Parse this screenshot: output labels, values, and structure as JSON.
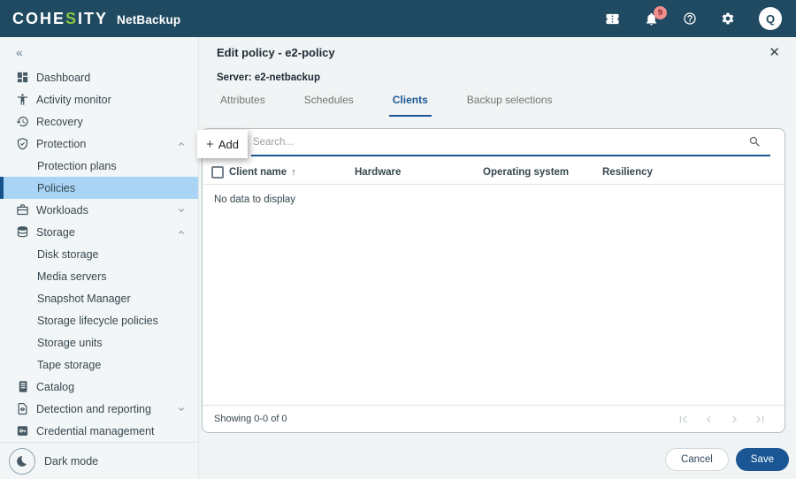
{
  "topbar": {
    "brand_pre": "COHE",
    "brand_s": "S",
    "brand_post": "ITY",
    "product": "NetBackup",
    "notification_count": "9",
    "avatar_letter": "Q"
  },
  "icons": {
    "collapse_glyph": "«",
    "close_glyph": "✕",
    "plus_glyph": "+",
    "sort_asc_glyph": "↑"
  },
  "sidebar": {
    "items": [
      {
        "label": "Dashboard",
        "icon": "dashboard-icon"
      },
      {
        "label": "Activity monitor",
        "icon": "activity-monitor-icon"
      },
      {
        "label": "Recovery",
        "icon": "recovery-icon"
      },
      {
        "label": "Protection",
        "icon": "shield-check-icon",
        "state": "expanded"
      },
      {
        "label": "Protection plans",
        "child": true
      },
      {
        "label": "Policies",
        "child": true,
        "selected": true
      },
      {
        "label": "Workloads",
        "icon": "briefcase-icon",
        "state": "collapsed"
      },
      {
        "label": "Storage",
        "icon": "database-icon",
        "state": "expanded"
      },
      {
        "label": "Disk storage",
        "child": true
      },
      {
        "label": "Media servers",
        "child": true
      },
      {
        "label": "Snapshot Manager",
        "child": true
      },
      {
        "label": "Storage lifecycle policies",
        "child": true
      },
      {
        "label": "Storage units",
        "child": true
      },
      {
        "label": "Tape storage",
        "child": true
      },
      {
        "label": "Catalog",
        "icon": "book-icon"
      },
      {
        "label": "Detection and reporting",
        "icon": "report-icon",
        "state": "collapsed"
      },
      {
        "label": "Credential management",
        "icon": "credential-key-icon"
      }
    ],
    "dark_mode_label": "Dark mode"
  },
  "panel": {
    "title": "Edit policy - e2-policy",
    "server": "Server: e2-netbackup",
    "tabs": [
      "Attributes",
      "Schedules",
      "Clients",
      "Backup selections"
    ],
    "active_tab": "Clients",
    "add_button": "Add",
    "search_placeholder": "Search...",
    "table": {
      "columns": [
        "Client name",
        "Hardware",
        "Operating system",
        "Resiliency"
      ],
      "sort_column": "Client name",
      "sort_direction": "ascending",
      "rows": [],
      "empty_message": "No data to display"
    },
    "footer": {
      "range_text": "Showing 0-0 of 0"
    },
    "actions": {
      "cancel": "Cancel",
      "save": "Save"
    }
  },
  "colors": {
    "topbar_bg": "#204A61",
    "brand_green": "#8DC63F",
    "accent_blue": "#1A5694",
    "selected_item_bg": "#A9D4F5",
    "selected_item_border": "#16548E",
    "badge_bg": "#F18E8E",
    "badge_text": "#8C2B2B",
    "card_border": "#B4BFC6"
  }
}
